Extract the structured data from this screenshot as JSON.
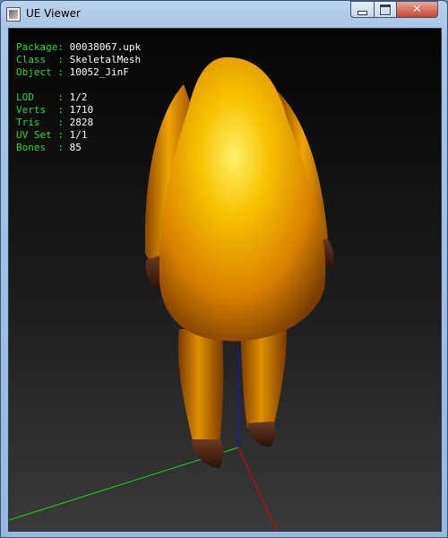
{
  "window": {
    "title": "UE Viewer"
  },
  "info": {
    "package": {
      "label": "Package",
      "value": "00038067.upk"
    },
    "class": {
      "label": "Class  ",
      "value": "SkeletalMesh"
    },
    "object": {
      "label": "Object ",
      "value": "10052_JinF"
    },
    "lod": {
      "label": "LOD    ",
      "value": "1/2"
    },
    "verts": {
      "label": "Verts  ",
      "value": "1710"
    },
    "tris": {
      "label": "Tris   ",
      "value": "2828"
    },
    "uvset": {
      "label": "UV Set ",
      "value": "1/1"
    },
    "bones": {
      "label": "Bones  ",
      "value": "85"
    },
    "separator": ": "
  },
  "colors": {
    "label": "#2ad634",
    "value": "#ffffff",
    "mesh": "#f0a000",
    "axis_x": "#e00000",
    "axis_y": "#1dd01d",
    "axis_z": "#1010e0"
  },
  "icons": {
    "app": "app-icon",
    "minimize": "minimize-icon",
    "maximize": "maximize-icon",
    "close": "close-icon"
  }
}
